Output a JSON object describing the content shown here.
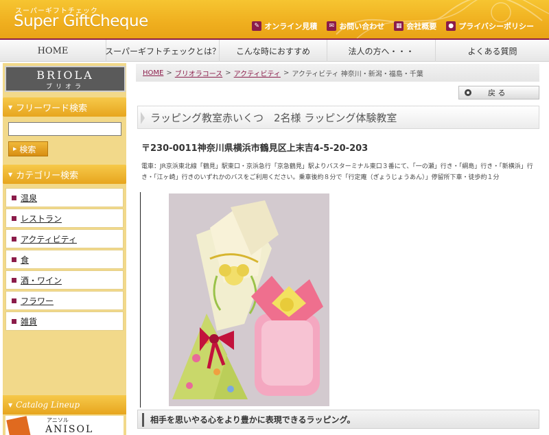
{
  "header": {
    "logo_sub": "スーパーギフトチェック",
    "logo_main": "Super GiftCheque",
    "links": [
      {
        "label": "オンライン見積",
        "icon": "pencil-icon"
      },
      {
        "label": "お問い合わせ",
        "icon": "mail-icon"
      },
      {
        "label": "会社概要",
        "icon": "building-icon"
      },
      {
        "label": "プライバシーポリシー",
        "icon": "lock-icon"
      }
    ]
  },
  "nav": {
    "items": [
      "HOME",
      "スーパーギフトチェックとは？",
      "こんな時におすすめ",
      "法人の方へ・・・",
      "よくある質問"
    ]
  },
  "sidebar": {
    "brand_main": "BRIOLA",
    "brand_sub": "ブリオラ",
    "freeword_title": "フリーワード検索",
    "search_value": "",
    "search_button": "検索",
    "category_title": "カテゴリー検索",
    "categories": [
      "温泉",
      "レストラン",
      "アクティビティ",
      "食",
      "酒・ワイン",
      "フラワー",
      "雑貨"
    ],
    "catalog_title": "Catalog Lineup",
    "catalog_item_kana": "アニソル",
    "catalog_item_name": "ANISOL"
  },
  "main": {
    "breadcrumb": {
      "links": [
        "HOME",
        "ブリオラコース",
        "アクティビティ"
      ],
      "current": "アクティビティ 神奈川・新潟・福島・千葉"
    },
    "back_label": "戻 る",
    "title": "ラッピング教室赤いくつ　2名様 ラッピング体験教室",
    "address": "〒230-0011神奈川県横浜市鶴見区上末吉4-5-20-203",
    "access": "電車：JR京浜東北線「鶴見」駅東口・京浜急行「京急鶴見」駅よりバスターミナル東口３番にて、「一の瀬」行き・「綱島」行き・「新横浜」行き・「江ヶ崎」行きのいずれかのバスをご利用ください。乗車後約８分で「行定庵（ぎょうじょうあん）」停留所下車・徒歩約１分",
    "subheading": "相手を思いやる心をより豊かに表現できるラッピング。"
  },
  "colors": {
    "accent": "#8b1c4a",
    "header_gold": "#f0b020",
    "sidebar_bg": "#f2d98a"
  }
}
